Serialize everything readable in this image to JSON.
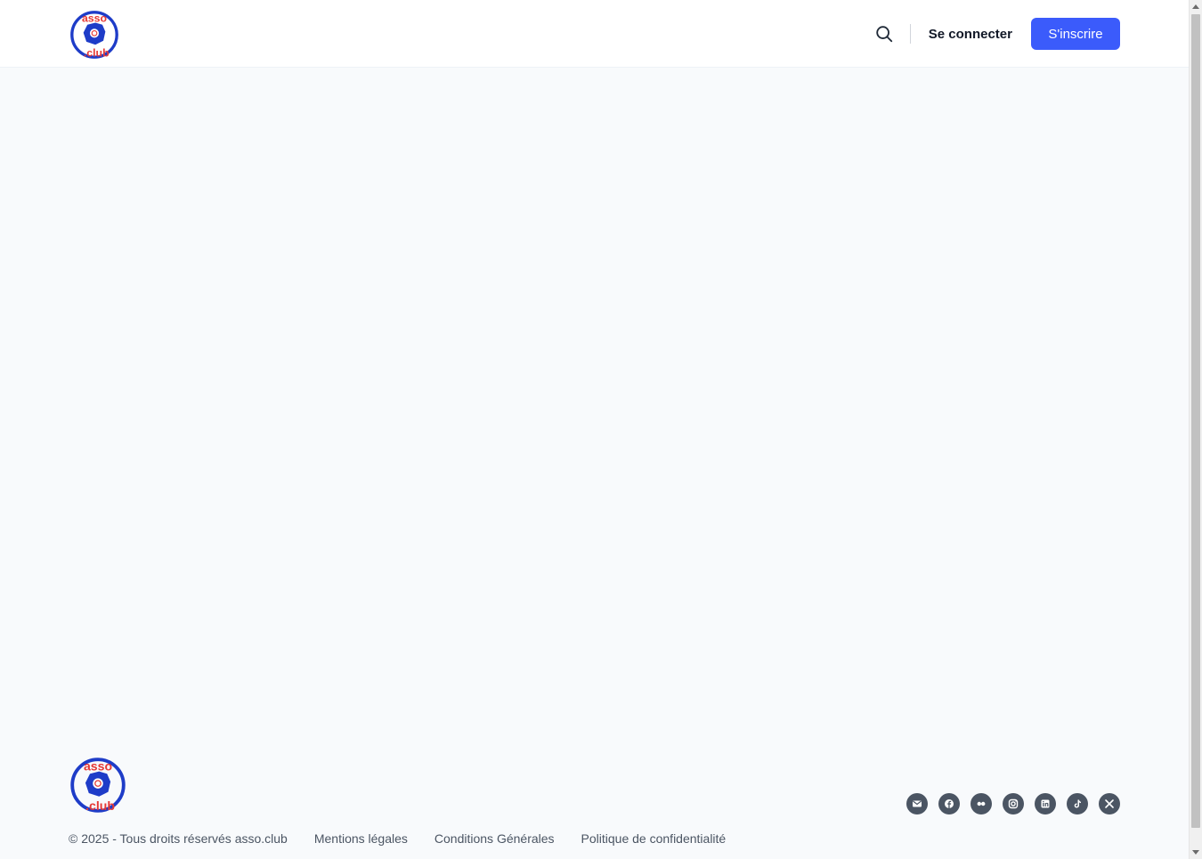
{
  "header": {
    "logo_alt": "asso.club",
    "logo_text_top": "asso",
    "logo_text_bottom": ".club",
    "search_icon": "search-icon",
    "login_label": "Se connecter",
    "signup_label": "S'inscrire"
  },
  "footer": {
    "copyright": "© 2025 - Tous droits réservés asso.club",
    "links": [
      {
        "label": "Mentions légales"
      },
      {
        "label": "Conditions Générales"
      },
      {
        "label": "Politique de confidentialité"
      }
    ],
    "socials": [
      {
        "icon": "mail-icon"
      },
      {
        "icon": "facebook-icon"
      },
      {
        "icon": "flickr-icon"
      },
      {
        "icon": "instagram-icon"
      },
      {
        "icon": "linkedin-icon"
      },
      {
        "icon": "tiktok-icon"
      },
      {
        "icon": "x-icon"
      }
    ]
  },
  "colors": {
    "page_bg": "#f8fafc",
    "header_bg": "#ffffff",
    "accent": "#3b5bfb",
    "text_dark": "#111827",
    "text_muted": "#4b5563",
    "logo_blue": "#1e3cc8",
    "logo_red": "#e53935"
  }
}
